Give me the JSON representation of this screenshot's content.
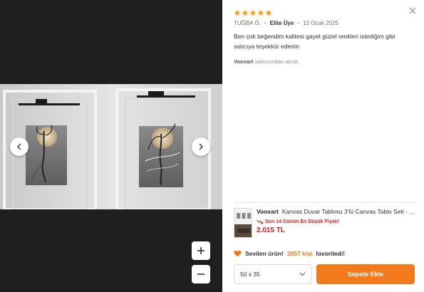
{
  "viewer": {
    "prev_icon": "chevron-left-icon",
    "next_icon": "chevron-right-icon",
    "zoom_in_icon": "plus-icon",
    "zoom_out_icon": "minus-icon"
  },
  "review": {
    "rating": 5,
    "max_rating": 5,
    "star_color": "#f5a623",
    "author": "TUĞBA Ö.",
    "badge": "Elite Üye",
    "date": "12 Ocak 2025",
    "text": "Ben çok beğendim kalitesi gayet güzel renkleri istediğim gibi satıcıya teşekkür ederim",
    "seller_name": "Voovart",
    "seller_suffix": "satıcısından alındı."
  },
  "product": {
    "seller": "Voovart",
    "title": "Kanvas Duvar Tablosu 3'lü Canvas Tablo Seti - ...",
    "lowest_price_text": "Son 14 Günün En Düşük Fiyatı!",
    "price": "2.015 TL",
    "price_color": "#d21f1f"
  },
  "favorites": {
    "prefix": "Sevilen ürün!",
    "count_text": "3857 kişi",
    "suffix": "favoriledi!",
    "icon": "heart-icon"
  },
  "actions": {
    "size_value": "50 x 35",
    "add_to_cart_label": "Sepete Ekle",
    "accent": "#f27a1a"
  },
  "close_icon": "close-icon"
}
